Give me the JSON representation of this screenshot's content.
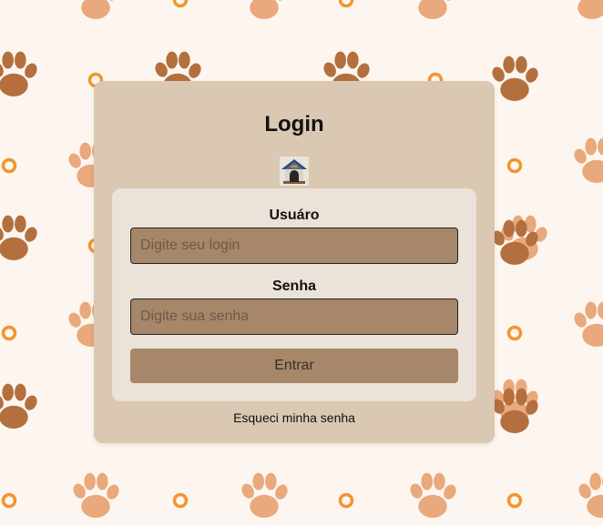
{
  "login": {
    "title": "Login",
    "logo_icon": "dog-house-icon",
    "username_label": "Usuáro",
    "username_placeholder": "Digite seu login",
    "username_value": "",
    "password_label": "Senha",
    "password_placeholder": "Digite sua senha",
    "password_value": "",
    "submit_label": "Entrar",
    "forgot_link": "Esqueci minha senha"
  },
  "background": {
    "pattern_icon": "paw-print-icon",
    "ring_icon": "ring-icon"
  },
  "colors": {
    "page_bg": "#fdf6f0",
    "card_bg": "#dac8b2",
    "inner_bg": "#ebe2d9",
    "field_bg": "#a6876a",
    "paw_dark": "#b3703e",
    "paw_light": "#e9a97c",
    "ring": "#f0962f"
  }
}
